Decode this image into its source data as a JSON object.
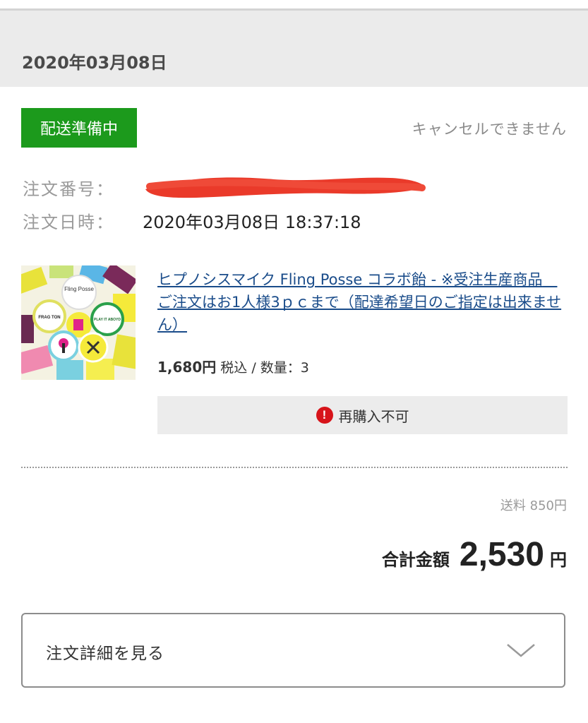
{
  "order": {
    "header_date": "2020年03月08日",
    "status": "配送準備中",
    "cancel_note": "キャンセルできません",
    "number_label": "注文番号：",
    "date_label": "注文日時：",
    "datetime": "2020年03月08日 18:37:18"
  },
  "product": {
    "title": "ヒプノシスマイク Fling Posse コラボ飴 - ※受注生産商品　ご注文はお1人様3ｐｃまで（配達希望日のご指定は出来ません）",
    "price": "1,680円",
    "price_suffix": " 税込 / 数量：3",
    "rebuy_notice": "再購入不可",
    "image_text": [
      "Fling Posse",
      "FRAG TON",
      "PLAY IT ABOYD"
    ]
  },
  "summary": {
    "shipping": "送料 850円",
    "total_label": "合計金額",
    "total_amount": "2,530",
    "total_currency": "円"
  },
  "detail_button": {
    "label": "注文詳細を見る"
  },
  "colors": {
    "status_green": "#1c9a1c",
    "link_blue": "#1a4c8a",
    "alert_red": "#d7141a",
    "redaction_red": "#ea3a2a"
  }
}
